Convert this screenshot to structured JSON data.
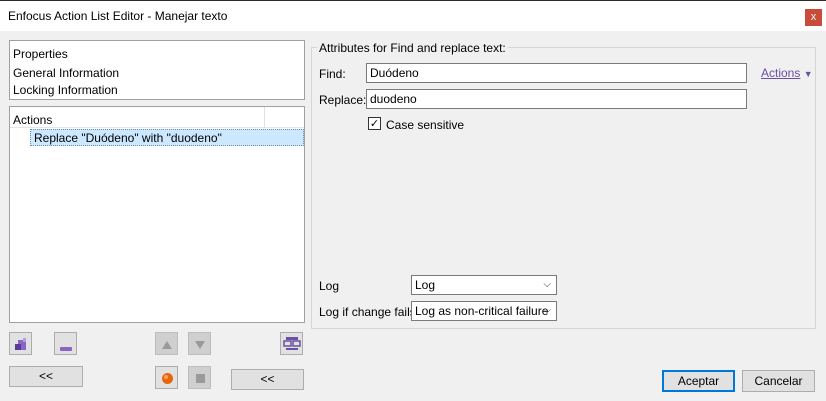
{
  "window": {
    "title": "Enfocus Action List Editor - Manejar texto",
    "close_label": "x"
  },
  "properties": {
    "header": "Properties",
    "items": [
      "General Information",
      "Locking Information"
    ]
  },
  "actions_list": {
    "header": "Actions",
    "items": [
      "Replace \"Duódeno\" with \"duodeno\""
    ]
  },
  "left_buttons": {
    "collapse_left": "<<",
    "collapse_mid": "<<"
  },
  "attributes": {
    "group_title": "Attributes for Find and replace text:",
    "actions_link": "Actions",
    "find_label": "Find:",
    "find_value": "Duódeno",
    "replace_label": "Replace:",
    "replace_value": "duodeno",
    "case_label": "Case sensitive",
    "case_checked": true,
    "log_label": "Log",
    "log_value": "Log",
    "logfail_label": "Log if change fails",
    "logfail_value": "Log as non-critical failure"
  },
  "footer": {
    "accept": "Aceptar",
    "cancel": "Cancelar"
  },
  "colors": {
    "accent": "#0078d7",
    "selection": "#cce8ff",
    "close": "#c94b3a",
    "link": "#6b4fa3"
  }
}
